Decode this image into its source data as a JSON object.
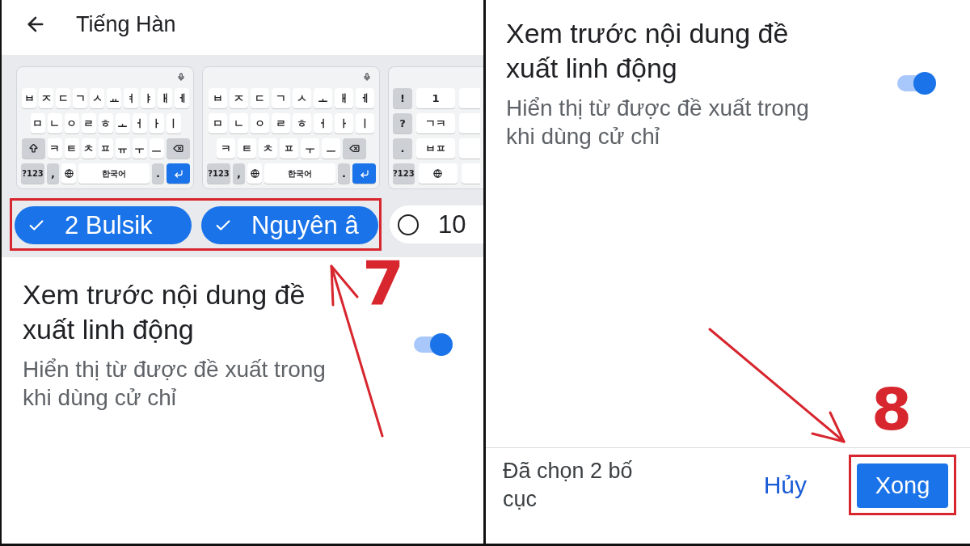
{
  "left_panel": {
    "header": {
      "title": "Tiếng Hàn"
    },
    "keyboard_previews": [
      {
        "kind": "standard",
        "rows": [
          {
            "keys": [
              {
                "kind": "char",
                "label": "ㅂ"
              },
              {
                "kind": "char",
                "label": "ㅈ"
              },
              {
                "kind": "char",
                "label": "ㄷ"
              },
              {
                "kind": "char",
                "label": "ㄱ"
              },
              {
                "kind": "char",
                "label": "ㅅ"
              },
              {
                "kind": "char",
                "label": "ㅛ"
              },
              {
                "kind": "char",
                "label": "ㅕ"
              },
              {
                "kind": "char",
                "label": "ㅑ"
              },
              {
                "kind": "char",
                "label": "ㅐ"
              },
              {
                "kind": "char",
                "label": "ㅔ"
              }
            ]
          },
          {
            "keys": [
              {
                "kind": "char",
                "label": "ㅁ"
              },
              {
                "kind": "char",
                "label": "ㄴ"
              },
              {
                "kind": "char",
                "label": "ㅇ"
              },
              {
                "kind": "char",
                "label": "ㄹ"
              },
              {
                "kind": "char",
                "label": "ㅎ"
              },
              {
                "kind": "char",
                "label": "ㅗ"
              },
              {
                "kind": "char",
                "label": "ㅓ"
              },
              {
                "kind": "char",
                "label": "ㅏ"
              },
              {
                "kind": "char",
                "label": "ㅣ"
              }
            ]
          },
          {
            "keys": [
              {
                "kind": "shift"
              },
              {
                "kind": "char",
                "label": "ㅋ"
              },
              {
                "kind": "char",
                "label": "ㅌ"
              },
              {
                "kind": "char",
                "label": "ㅊ"
              },
              {
                "kind": "char",
                "label": "ㅍ"
              },
              {
                "kind": "char",
                "label": "ㅠ"
              },
              {
                "kind": "char",
                "label": "ㅜ"
              },
              {
                "kind": "char",
                "label": "ㅡ"
              },
              {
                "kind": "backspace"
              }
            ]
          },
          {
            "keys": [
              {
                "kind": "symbols",
                "label": "?123"
              },
              {
                "kind": "punct",
                "label": ","
              },
              {
                "kind": "globe"
              },
              {
                "kind": "space",
                "label": "한국어"
              },
              {
                "kind": "punct",
                "label": "."
              },
              {
                "kind": "enter"
              }
            ]
          }
        ]
      },
      {
        "kind": "standard",
        "rows": [
          {
            "keys": [
              {
                "kind": "char",
                "label": "ㅂ"
              },
              {
                "kind": "char",
                "label": "ㅈ"
              },
              {
                "kind": "char",
                "label": "ㄷ"
              },
              {
                "kind": "char",
                "label": "ㄱ"
              },
              {
                "kind": "char",
                "label": "ㅅ"
              },
              {
                "kind": "char",
                "label": "ㅗ"
              },
              {
                "kind": "char",
                "label": "ㅐ"
              },
              {
                "kind": "char",
                "label": "ㅔ"
              }
            ]
          },
          {
            "keys": [
              {
                "kind": "char",
                "label": "ㅁ"
              },
              {
                "kind": "char",
                "label": "ㄴ"
              },
              {
                "kind": "char",
                "label": "ㅇ"
              },
              {
                "kind": "char",
                "label": "ㄹ"
              },
              {
                "kind": "char",
                "label": "ㅎ"
              },
              {
                "kind": "char",
                "label": "ㅓ"
              },
              {
                "kind": "char",
                "label": "ㅏ"
              },
              {
                "kind": "char",
                "label": "ㅣ"
              }
            ]
          },
          {
            "keys": [
              {
                "kind": "char",
                "label": "ㅋ"
              },
              {
                "kind": "char",
                "label": "ㅌ"
              },
              {
                "kind": "char",
                "label": "ㅊ"
              },
              {
                "kind": "char",
                "label": "ㅍ"
              },
              {
                "kind": "char",
                "label": "ㅜ"
              },
              {
                "kind": "char",
                "label": "ㅡ"
              },
              {
                "kind": "backspace"
              }
            ]
          },
          {
            "keys": [
              {
                "kind": "symbols",
                "label": "?123"
              },
              {
                "kind": "punct",
                "label": ","
              },
              {
                "kind": "globe"
              },
              {
                "kind": "space",
                "label": "한국어"
              },
              {
                "kind": "punct",
                "label": "."
              },
              {
                "kind": "enter"
              }
            ]
          }
        ]
      },
      {
        "kind": "tenkey",
        "rows": [
          {
            "keys": [
              {
                "kind": "side",
                "label": "!"
              },
              {
                "kind": "char",
                "label": "1"
              }
            ]
          },
          {
            "keys": [
              {
                "kind": "side",
                "label": "?"
              },
              {
                "kind": "char",
                "label": "ㄱㅋ"
              }
            ]
          },
          {
            "keys": [
              {
                "kind": "side",
                "label": "."
              },
              {
                "kind": "char",
                "label": "ㅂㅍ"
              }
            ]
          },
          {
            "keys": [
              {
                "kind": "symbols",
                "label": "?123"
              },
              {
                "kind": "globe"
              }
            ]
          }
        ]
      }
    ],
    "layout_chips": [
      {
        "label": "2 Bulsik",
        "selected": true
      },
      {
        "label": "Nguyên â",
        "selected": true
      },
      {
        "label": "10",
        "selected": false
      }
    ],
    "step_label": "7",
    "setting": {
      "title": "Xem trước nội dung đề xuất linh động",
      "description": "Hiển thị từ được đề xuất trong khi dùng cử chỉ",
      "on": true
    }
  },
  "right_panel": {
    "setting": {
      "title": "Xem trước nội dung đề xuất linh động",
      "description": "Hiển thị từ được đề xuất trong khi dùng cử chỉ",
      "on": true
    },
    "step_label": "8",
    "footer": {
      "status": "Đã chọn 2 bố cục",
      "cancel_button": "Hủy",
      "done_button": "Xong"
    }
  }
}
